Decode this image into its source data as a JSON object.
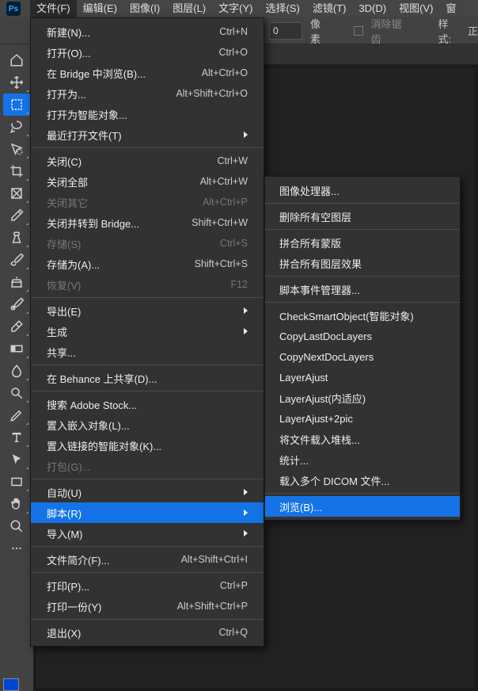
{
  "menubar": {
    "items": [
      "文件(F)",
      "编辑(E)",
      "图像(I)",
      "图层(L)",
      "文字(Y)",
      "选择(S)",
      "滤镜(T)",
      "3D(D)",
      "视图(V)",
      "窗"
    ]
  },
  "optionsbar": {
    "unit_value": "0",
    "unit_label": "像素",
    "antialias": "消除锯齿",
    "style_label": "样式:",
    "style_value": "正"
  },
  "file_menu": [
    {
      "label": "新建(N)...",
      "shortcut": "Ctrl+N"
    },
    {
      "label": "打开(O)...",
      "shortcut": "Ctrl+O"
    },
    {
      "label": "在 Bridge 中浏览(B)...",
      "shortcut": "Alt+Ctrl+O"
    },
    {
      "label": "打开为...",
      "shortcut": "Alt+Shift+Ctrl+O"
    },
    {
      "label": "打开为智能对象..."
    },
    {
      "label": "最近打开文件(T)",
      "arrow": true
    },
    {
      "sep": true
    },
    {
      "label": "关闭(C)",
      "shortcut": "Ctrl+W"
    },
    {
      "label": "关闭全部",
      "shortcut": "Alt+Ctrl+W"
    },
    {
      "label": "关闭其它",
      "shortcut": "Alt+Ctrl+P",
      "disabled": true
    },
    {
      "label": "关闭并转到 Bridge...",
      "shortcut": "Shift+Ctrl+W"
    },
    {
      "label": "存储(S)",
      "shortcut": "Ctrl+S",
      "disabled": true
    },
    {
      "label": "存储为(A)...",
      "shortcut": "Shift+Ctrl+S"
    },
    {
      "label": "恢复(V)",
      "shortcut": "F12",
      "disabled": true
    },
    {
      "sep": true
    },
    {
      "label": "导出(E)",
      "arrow": true
    },
    {
      "label": "生成",
      "arrow": true
    },
    {
      "label": "共享..."
    },
    {
      "sep": true
    },
    {
      "label": "在 Behance 上共享(D)..."
    },
    {
      "sep": true
    },
    {
      "label": "搜索 Adobe Stock..."
    },
    {
      "label": "置入嵌入对象(L)..."
    },
    {
      "label": "置入链接的智能对象(K)..."
    },
    {
      "label": "打包(G)...",
      "disabled": true
    },
    {
      "sep": true
    },
    {
      "label": "自动(U)",
      "arrow": true
    },
    {
      "label": "脚本(R)",
      "arrow": true,
      "highlight": true
    },
    {
      "label": "导入(M)",
      "arrow": true
    },
    {
      "sep": true
    },
    {
      "label": "文件简介(F)...",
      "shortcut": "Alt+Shift+Ctrl+I"
    },
    {
      "sep": true
    },
    {
      "label": "打印(P)...",
      "shortcut": "Ctrl+P"
    },
    {
      "label": "打印一份(Y)",
      "shortcut": "Alt+Shift+Ctrl+P"
    },
    {
      "sep": true
    },
    {
      "label": "退出(X)",
      "shortcut": "Ctrl+Q"
    }
  ],
  "scripts_menu": [
    {
      "label": "图像处理器..."
    },
    {
      "sep": true
    },
    {
      "label": "删除所有空图层"
    },
    {
      "sep": true
    },
    {
      "label": "拼合所有蒙版"
    },
    {
      "label": "拼合所有图层效果"
    },
    {
      "sep": true
    },
    {
      "label": "脚本事件管理器..."
    },
    {
      "sep": true
    },
    {
      "label": "CheckSmartObject(智能对象)"
    },
    {
      "label": "CopyLastDocLayers"
    },
    {
      "label": "CopyNextDocLayers"
    },
    {
      "label": "LayerAjust"
    },
    {
      "label": "LayerAjust(内适应)"
    },
    {
      "label": "LayerAjust+2pic"
    },
    {
      "label": "将文件载入堆栈..."
    },
    {
      "label": "统计..."
    },
    {
      "label": "载入多个 DICOM 文件..."
    },
    {
      "sep": true
    },
    {
      "label": "浏览(B)...",
      "highlight": true
    }
  ],
  "tools": [
    {
      "name": "home-icon"
    },
    {
      "name": "move-tool",
      "tri": true
    },
    {
      "name": "marquee-tool",
      "tri": true,
      "active": true
    },
    {
      "name": "lasso-tool",
      "tri": true
    },
    {
      "name": "quick-select-tool",
      "tri": true
    },
    {
      "name": "crop-tool",
      "tri": true
    },
    {
      "name": "frame-tool",
      "tri": true
    },
    {
      "name": "eyedropper-tool",
      "tri": true
    },
    {
      "name": "spot-heal-tool",
      "tri": true
    },
    {
      "name": "brush-tool",
      "tri": true
    },
    {
      "name": "clone-stamp-tool",
      "tri": true
    },
    {
      "name": "history-brush-tool",
      "tri": true
    },
    {
      "name": "eraser-tool",
      "tri": true
    },
    {
      "name": "gradient-tool",
      "tri": true
    },
    {
      "name": "blur-tool",
      "tri": true
    },
    {
      "name": "dodge-tool",
      "tri": true
    },
    {
      "name": "pen-tool",
      "tri": true
    },
    {
      "name": "type-tool",
      "tri": true
    },
    {
      "name": "path-select-tool",
      "tri": true
    },
    {
      "name": "rectangle-tool",
      "tri": true
    },
    {
      "name": "hand-tool",
      "tri": true
    },
    {
      "name": "zoom-tool"
    },
    {
      "name": "more-tool"
    }
  ]
}
